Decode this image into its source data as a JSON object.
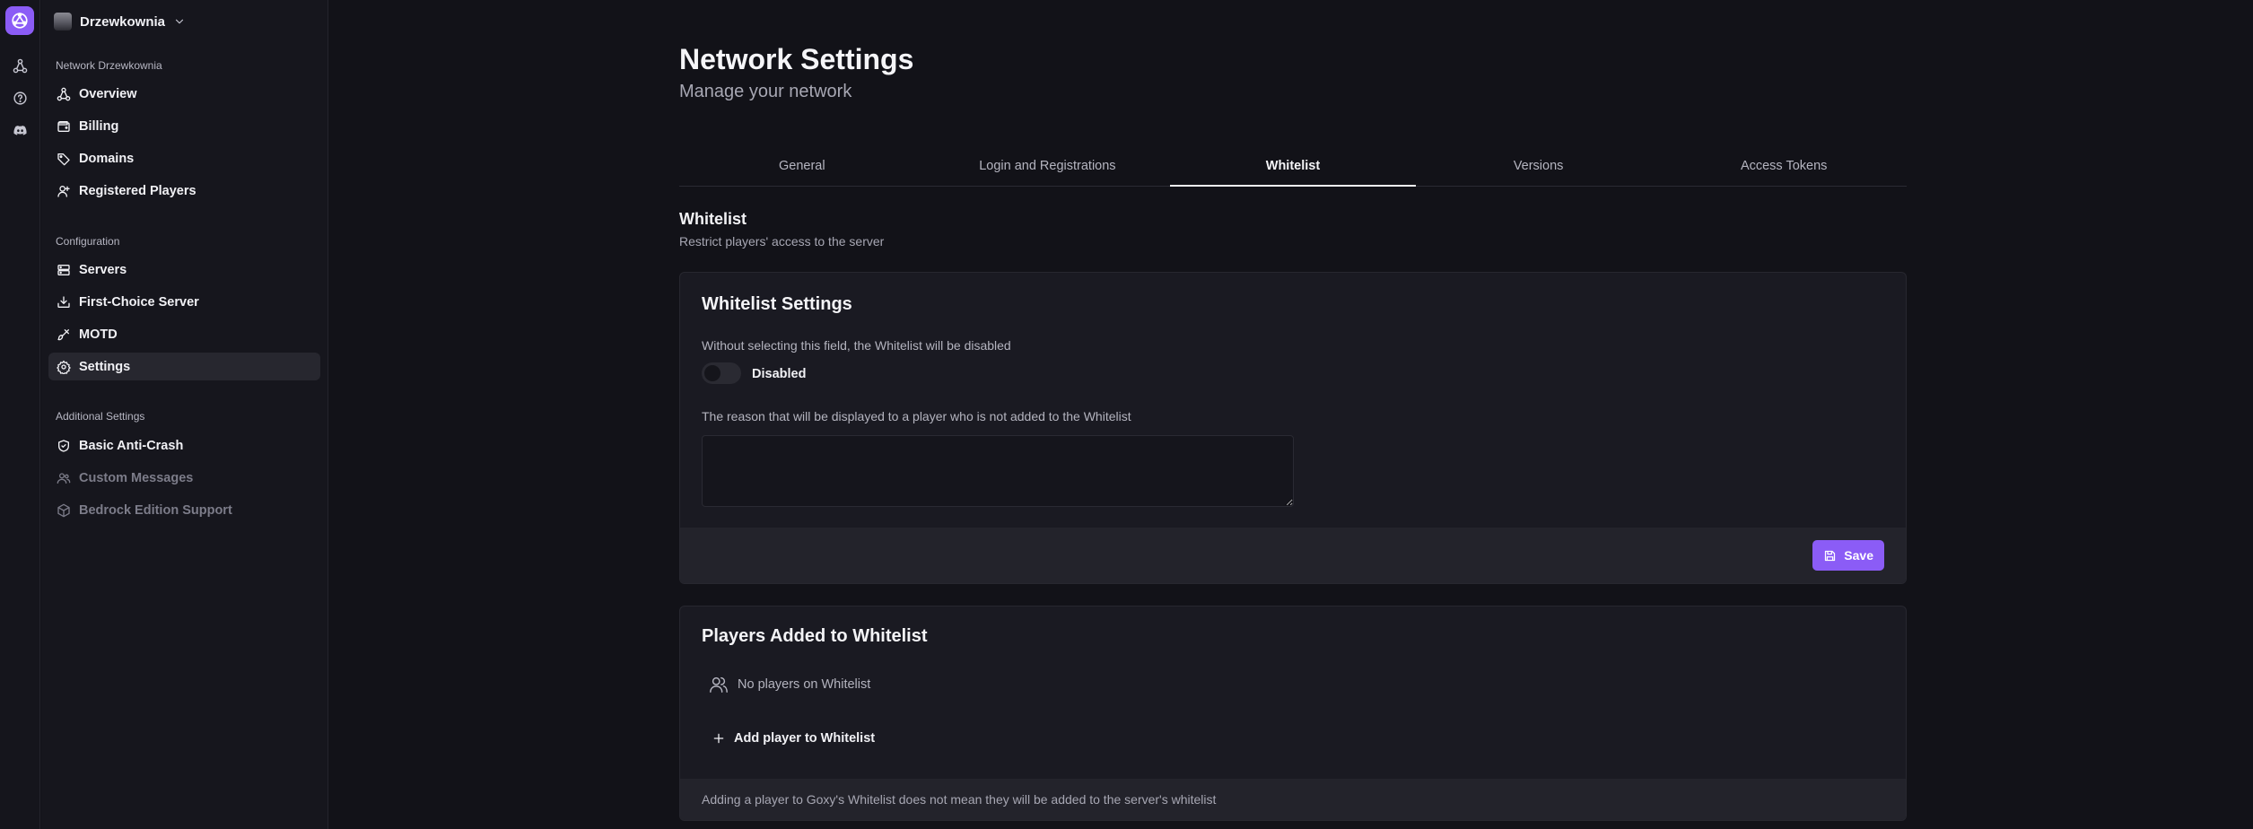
{
  "rail": {
    "icons": [
      "network-icon",
      "help-icon",
      "discord-icon"
    ]
  },
  "sidebar": {
    "org_name": "Drzewkownia",
    "sections": [
      {
        "title": "Network Drzewkownia",
        "items": [
          {
            "label": "Overview",
            "icon": "network-icon"
          },
          {
            "label": "Billing",
            "icon": "wallet-icon"
          },
          {
            "label": "Domains",
            "icon": "tag-icon"
          },
          {
            "label": "Registered Players",
            "icon": "user-icon"
          }
        ]
      },
      {
        "title": "Configuration",
        "items": [
          {
            "label": "Servers",
            "icon": "server-icon"
          },
          {
            "label": "First-Choice Server",
            "icon": "download-icon"
          },
          {
            "label": "MOTD",
            "icon": "brush-icon"
          },
          {
            "label": "Settings",
            "icon": "gear-icon",
            "active": true
          }
        ]
      },
      {
        "title": "Additional Settings",
        "items": [
          {
            "label": "Basic Anti-Crash",
            "icon": "shield-icon"
          },
          {
            "label": "Custom Messages",
            "icon": "users-icon",
            "disabled": true
          },
          {
            "label": "Bedrock Edition Support",
            "icon": "cube-icon",
            "disabled": true
          }
        ]
      }
    ]
  },
  "main": {
    "title": "Network Settings",
    "subtitle": "Manage your network",
    "tabs": [
      {
        "label": "General"
      },
      {
        "label": "Login and Registrations"
      },
      {
        "label": "Whitelist",
        "active": true
      },
      {
        "label": "Versions"
      },
      {
        "label": "Access Tokens"
      }
    ],
    "section_title": "Whitelist",
    "section_desc": "Restrict players' access to the server",
    "settings_card": {
      "title": "Whitelist Settings",
      "toggle_label": "Without selecting this field, the Whitelist will be disabled",
      "toggle_state": "Disabled",
      "reason_label": "The reason that will be displayed to a player who is not added to the Whitelist",
      "reason_value": "",
      "save_label": "Save"
    },
    "players_card": {
      "title": "Players Added to Whitelist",
      "empty_text": "No players on Whitelist",
      "add_label": "Add player to Whitelist",
      "note": "Adding a player to Goxy's Whitelist does not mean they will be added to the server's whitelist"
    }
  },
  "colors": {
    "accent": "#8b5cf6",
    "background": "#121218",
    "surface": "#1a1a22"
  }
}
